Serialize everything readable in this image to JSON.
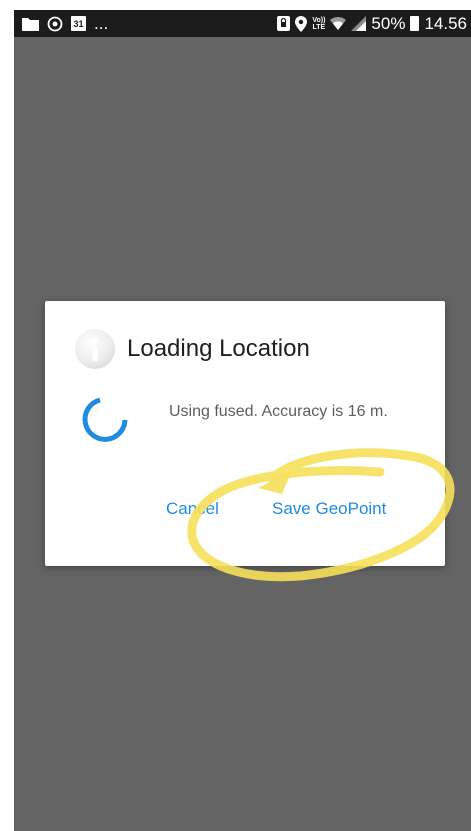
{
  "status_bar": {
    "left_icons": [
      "folder-icon",
      "sync-icon",
      "calendar-icon"
    ],
    "calendar_day": "31",
    "overflow_text": "...",
    "right_icons": [
      "shield-icon",
      "location-pin-icon",
      "volte-lte-icon",
      "wifi-icon",
      "cell-signal-icon"
    ],
    "lte_top": "Vo))",
    "lte_bottom": "LTE",
    "battery_percent": "50%",
    "time": "14.56"
  },
  "dialog": {
    "title": "Loading Location",
    "message": "Using fused. Accuracy is 16 m.",
    "cancel_label": "Cancel",
    "save_label": "Save GeoPoint"
  },
  "colors": {
    "accent": "#1f8ce0",
    "screen_background": "#646464",
    "status_bar": "#1c1c1c",
    "highlight": "#f6e05a"
  }
}
